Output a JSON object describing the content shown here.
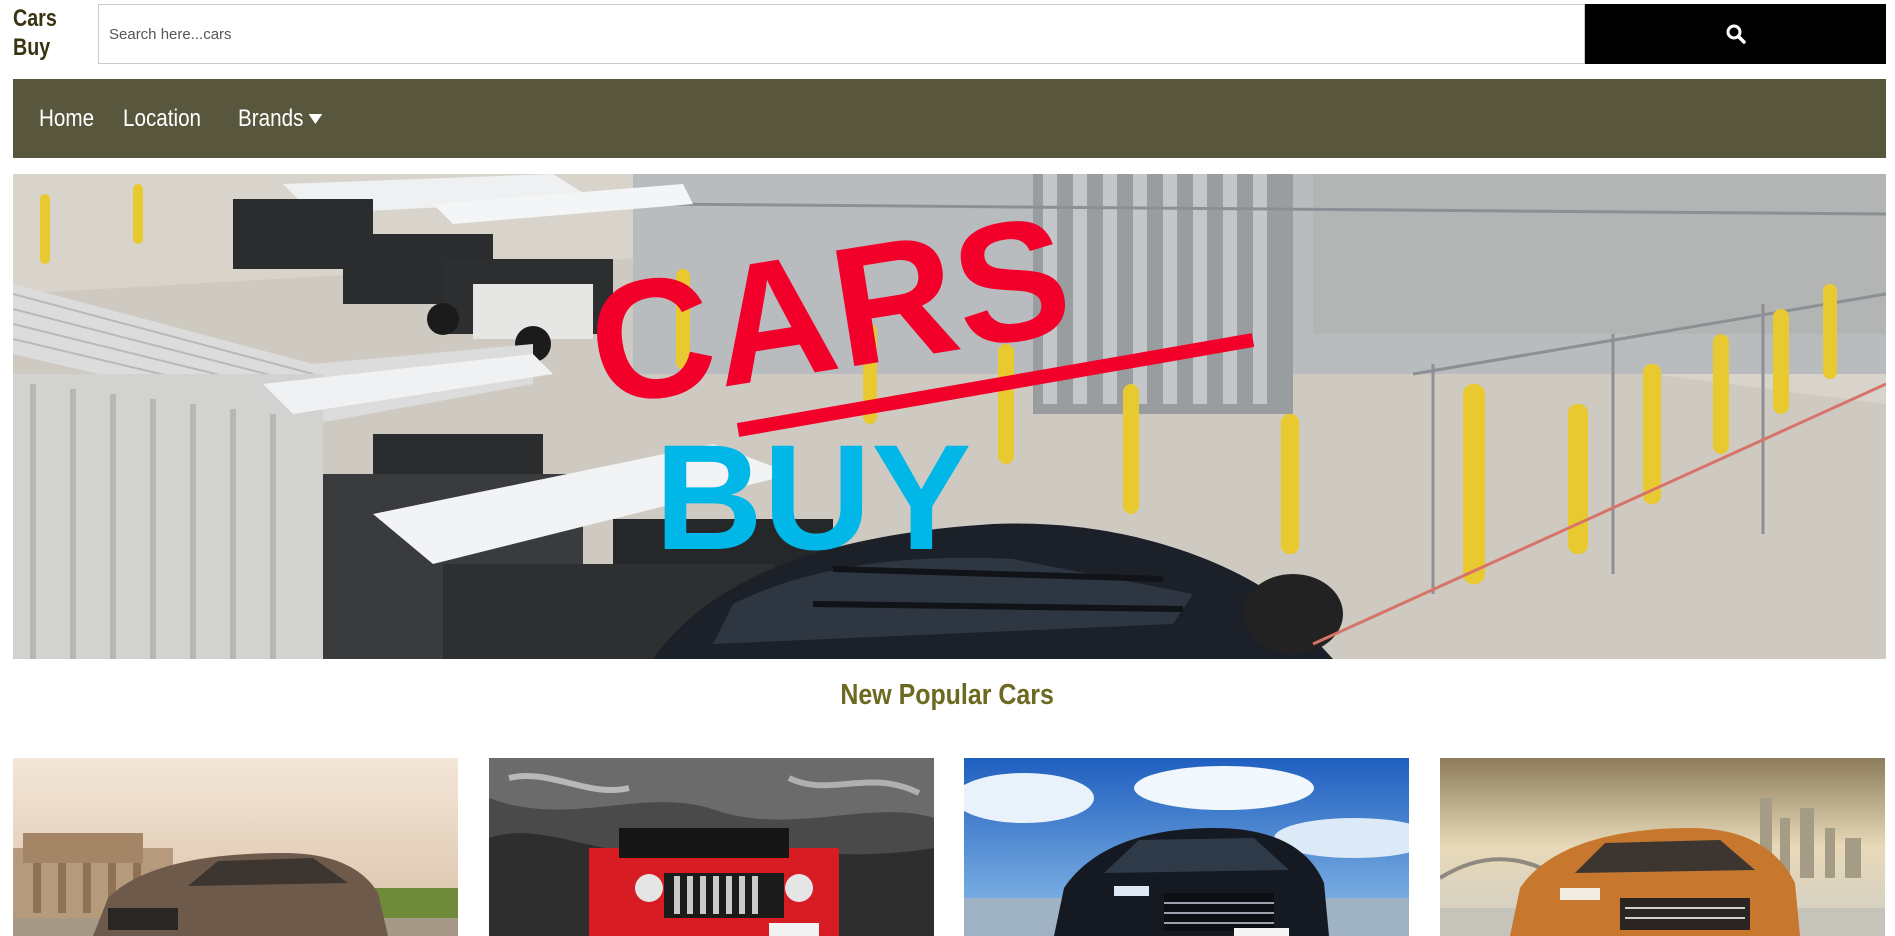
{
  "header": {
    "logo": "Cars Buy",
    "search": {
      "placeholder": "Search here...cars",
      "value": ""
    },
    "search_button_icon": "search-icon"
  },
  "nav": {
    "items": [
      {
        "label": "Home"
      },
      {
        "label": "Location"
      },
      {
        "label": "Brands",
        "icon": "caret-down-icon"
      }
    ],
    "background": "#58573d"
  },
  "hero": {
    "logo_line1": "CARS",
    "logo_line2": "BUY",
    "logo_colors": {
      "cars": "#f2002a",
      "buy": "#00b7e8"
    }
  },
  "section": {
    "title": "New Popular Cars",
    "title_color": "#6b6a20"
  },
  "cards": [
    {
      "name": "brown-suv",
      "color": "#6e5a4a"
    },
    {
      "name": "red-jeep",
      "color": "#d81c24"
    },
    {
      "name": "black-suv",
      "color": "#151a22"
    },
    {
      "name": "orange-suv",
      "color": "#c8772e"
    }
  ]
}
